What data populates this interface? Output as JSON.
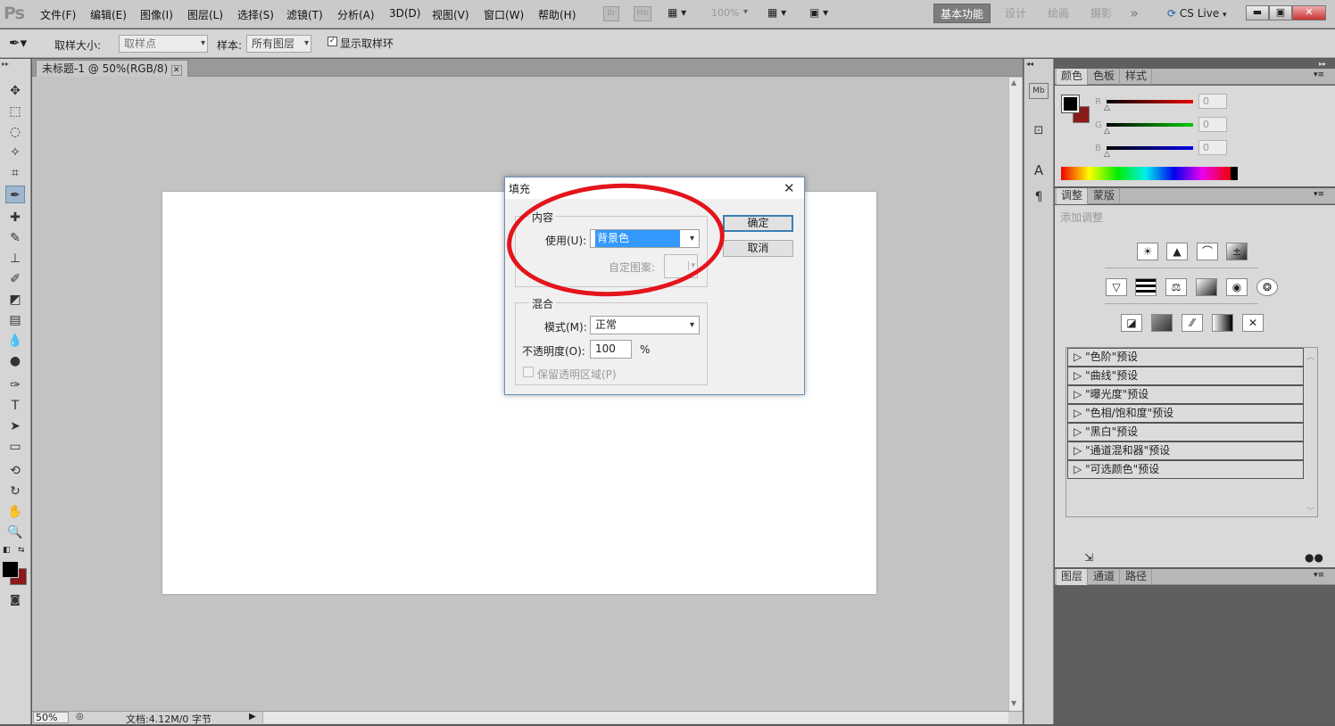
{
  "app": {
    "logo": "Ps"
  },
  "menu": [
    "文件(F)",
    "编辑(E)",
    "图像(I)",
    "图层(L)",
    "选择(S)",
    "滤镜(T)",
    "分析(A)",
    "3D(D)",
    "视图(V)",
    "窗口(W)",
    "帮助(H)"
  ],
  "menubar_tools": {
    "br": "Br",
    "mb": "Mb",
    "zoom": "100%"
  },
  "workspaces": [
    "基本功能",
    "设计",
    "绘画",
    "摄影"
  ],
  "workspace_more": "»",
  "cslive": "CS Live",
  "options": {
    "sample_size_label": "取样大小:",
    "sample_size_value": "取样点",
    "sample_label": "样本:",
    "sample_value": "所有图层",
    "show_ring_label": "显示取样环",
    "show_ring_checked": true
  },
  "document": {
    "tab_title": "未标题-1 @ 50%(RGB/8)"
  },
  "status": {
    "zoom": "50%",
    "doc_info": "文档:4.12M/0 字节"
  },
  "color_panel": {
    "tabs": [
      "颜色",
      "色板",
      "样式"
    ],
    "channels": [
      {
        "label": "R",
        "value": "0"
      },
      {
        "label": "G",
        "value": "0"
      },
      {
        "label": "B",
        "value": "0"
      }
    ],
    "foreground": "#000000",
    "background": "#8b1a1a"
  },
  "adjust_panel": {
    "tabs": [
      "调整",
      "蒙版"
    ],
    "hint": "添加调整",
    "presets": [
      "\"色阶\"预设",
      "\"曲线\"预设",
      "\"曝光度\"预设",
      "\"色相/饱和度\"预设",
      "\"黑白\"预设",
      "\"通道混和器\"预设",
      "\"可选颜色\"预设"
    ]
  },
  "layers_panel": {
    "tabs": [
      "图层",
      "通道",
      "路径"
    ]
  },
  "dialog": {
    "title": "填充",
    "contents_group": "内容",
    "use_label": "使用(U):",
    "use_value": "背景色",
    "custom_pattern_label": "自定图案:",
    "blend_group": "混合",
    "mode_label": "模式(M):",
    "mode_value": "正常",
    "opacity_label": "不透明度(O):",
    "opacity_value": "100",
    "opacity_unit": "%",
    "preserve_label": "保留透明区域(P)",
    "ok": "确定",
    "cancel": "取消"
  },
  "annotation_color": "#e3141b"
}
